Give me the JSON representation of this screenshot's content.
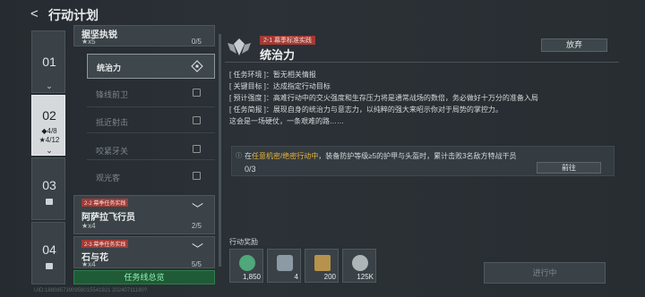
{
  "header": {
    "back_label": "<",
    "title": "行动计划"
  },
  "chapters": [
    {
      "num": "01",
      "chev": "⌄",
      "locked": false
    },
    {
      "num": "02",
      "stat1": "◆4/8",
      "stat2": "★4/12",
      "chev": "⌄",
      "locked": false,
      "active": true
    },
    {
      "num": "03",
      "locked": true
    },
    {
      "num": "04",
      "locked": true
    }
  ],
  "missions": {
    "top_item": {
      "name": "据坚执锐",
      "stars": "★x5",
      "count": "0/5"
    },
    "subs": [
      {
        "name": "统治力",
        "active": true
      },
      {
        "name": "锋线前卫"
      },
      {
        "name": "抵近射击"
      },
      {
        "name": "咬紧牙关"
      },
      {
        "name": "观光客"
      }
    ],
    "item2": {
      "tag": "2-2 幕季任务实践",
      "name": "阿萨拉飞行员",
      "stars": "★x4",
      "count": "2/5"
    },
    "item3": {
      "tag": "2-3 幕季任务实践",
      "name": "石与花",
      "stars": "★x4",
      "count": "5/5"
    },
    "overview_label": "任务线总览"
  },
  "detail": {
    "tag": "2-1 幕季标准实践",
    "name": "统治力",
    "giveup_label": "放弃",
    "info": [
      "[ 任务环境 ]：暂无相关情报",
      "[ 关键目标 ]：达成指定行动目标",
      "[ 预计强度 ]：高难行动中的交火强度和生存压力将是通常战场的数倍，务必做好十万分的准备入局",
      "[ 任务简报 ]：展现自身的统治力与意志力，以纯粹的强大来昭示你对于局势的掌控力。",
      "这会是一场硬仗，一条艰难的路……"
    ],
    "task": {
      "prefix": "在",
      "highlight": "任意机密/绝密行动中",
      "suffix": "，装备防护等级≥5的护甲与头盔时，累计击败3名敌方特战干员",
      "progress": "0/3",
      "goto_label": "前往"
    }
  },
  "rewards": {
    "label": "行动奖励",
    "items": [
      {
        "icon": "badge-icon",
        "amount": "1,850",
        "color": "#4fa77a"
      },
      {
        "icon": "tape-icon",
        "amount": "4",
        "color": "#8b9aa3"
      },
      {
        "icon": "ammo-icon",
        "amount": "200",
        "color": "#b7924d"
      },
      {
        "icon": "coin-icon",
        "amount": "125K",
        "color": "#aeb5b8"
      }
    ]
  },
  "status_label": "进行中",
  "footer": "UID:1880857390959015541921 20240711180?"
}
